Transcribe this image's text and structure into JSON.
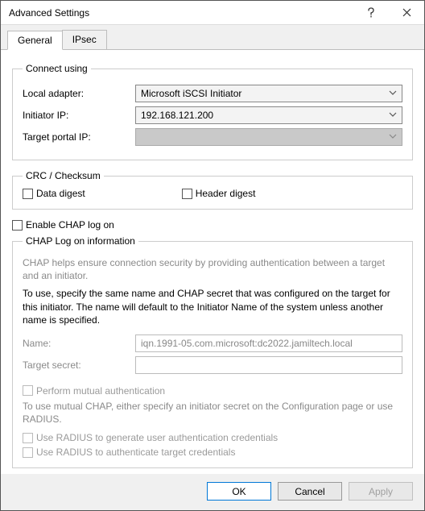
{
  "window": {
    "title": "Advanced Settings"
  },
  "tabs": {
    "general": "General",
    "ipsec": "IPsec"
  },
  "connect": {
    "legend": "Connect using",
    "local_adapter_label": "Local adapter:",
    "local_adapter_value": "Microsoft iSCSI Initiator",
    "initiator_ip_label": "Initiator IP:",
    "initiator_ip_value": "192.168.121.200",
    "target_portal_ip_label": "Target portal IP:",
    "target_portal_ip_value": ""
  },
  "crc": {
    "legend": "CRC / Checksum",
    "data_digest": "Data digest",
    "header_digest": "Header digest"
  },
  "chap": {
    "enable_label": "Enable CHAP log on",
    "legend": "CHAP Log on information",
    "help1": "CHAP helps ensure connection security by providing authentication between a target and an initiator.",
    "help2": "To use, specify the same name and CHAP secret that was configured on the target for this initiator.  The name will default to the Initiator Name of the system unless another name is specified.",
    "name_label": "Name:",
    "name_value": "iqn.1991-05.com.microsoft:dc2022.jamiltech.local",
    "secret_label": "Target secret:",
    "secret_value": "",
    "mutual_label": "Perform mutual authentication",
    "mutual_help": "To use mutual CHAP, either specify an initiator secret on the Configuration page or use RADIUS.",
    "radius_gen": "Use RADIUS to generate user authentication credentials",
    "radius_auth": "Use RADIUS to authenticate target credentials"
  },
  "buttons": {
    "ok": "OK",
    "cancel": "Cancel",
    "apply": "Apply"
  }
}
